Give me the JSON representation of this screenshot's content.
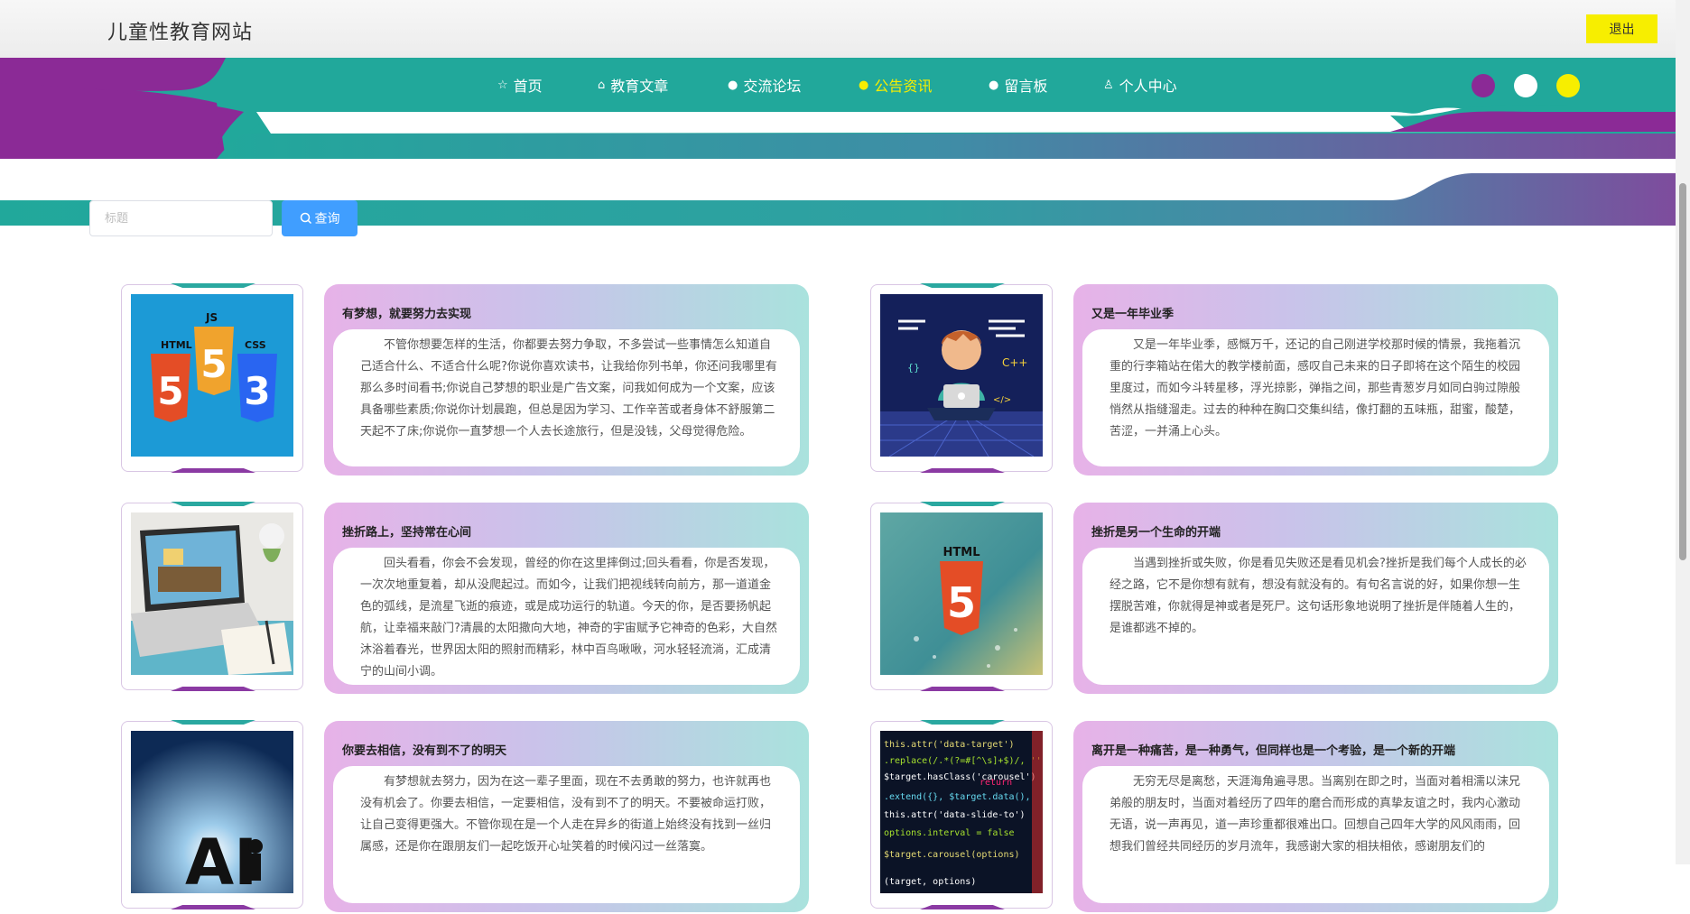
{
  "header": {
    "site_title": "儿童性教育网站",
    "logout_label": "退出"
  },
  "nav": [
    {
      "label": "首页",
      "icon": "star-icon",
      "glyph": "☆"
    },
    {
      "label": "教育文章",
      "icon": "bag-icon",
      "glyph": "⌂"
    },
    {
      "label": "交流论坛",
      "icon": "warning-circle-icon",
      "glyph": "●"
    },
    {
      "label": "公告资讯",
      "icon": "question-circle-icon",
      "glyph": "●",
      "active": true
    },
    {
      "label": "留言板",
      "icon": "info-circle-icon",
      "glyph": "●"
    },
    {
      "label": "个人中心",
      "icon": "user-icon",
      "glyph": "♙"
    }
  ],
  "theme_dots": [
    "#8b2a96",
    "#ffffff",
    "#f7ee00"
  ],
  "search": {
    "placeholder": "标题",
    "button_label": "查询"
  },
  "colors": {
    "nav_teal": "#21a89b",
    "nav_purple": "#8b2a96",
    "accent_yellow": "#f7ee00",
    "button_blue": "#409eff"
  },
  "articles": [
    {
      "title": "有梦想，就要努力去实现",
      "body": "不管你想要怎样的生活，你都要去努力争取，不多尝试一些事情怎么知道自己适合什么、不适合什么呢?你说你喜欢读书，让我给你列书单，你还问我哪里有那么多时间看书;你说自己梦想的职业是广告文案，问我如何成为一个文案，应该具备哪些素质;你说你计划晨跑，但总是因为学习、工作辛苦或者身体不舒服第二天起不了床;你说你一直梦想一个人去长途旅行，但是没钱，父母觉得危险。",
      "image": "html5-css3-js-badges"
    },
    {
      "title": "又是一年毕业季",
      "body": "又是一年毕业季，感慨万千，还记的自己刚进学校那时候的情景，我拖着沉重的行李箱站在偌大的教学楼前面，感叹自己未来的日子即将在这个陌生的校园里度过，而如今斗转星移，浮光掠影，弹指之间，那些青葱岁月如同白驹过隙般悄然从指缝溜走。过去的种种在胸口交集纠结，像打翻的五味瓶，甜蜜，酸楚，苦涩，一并涌上心头。",
      "image": "meditating-coder-illustration"
    },
    {
      "title": "挫折路上，坚持常在心间",
      "body": "回头看看，你会不会发现，曾经的你在这里摔倒过;回头看看，你是否发现，一次次地重复着，却从没爬起过。而如今，让我们把视线转向前方，那一道道金色的弧线，是流星飞逝的痕迹，或是成功运行的轨道。今天的你，是否要扬帆起航，让幸福来敲门?清晨的太阳撒向大地，神奇的宇宙赋予它神奇的色彩，大自然沐浴着春光，世界因太阳的照射而精彩，林中百鸟啾啾，河水轻轻流淌，汇成清宁的山间小调。",
      "image": "laptop-desk-photo"
    },
    {
      "title": "挫折是另一个生命的开端",
      "body": "当遇到挫折或失败，你是看见失败还是看见机会?挫折是我们每个人成长的必经之路，它不是你想有就有，想没有就没有的。有句名言说的好，如果你想一生摆脱苦难，你就得是神或者是死尸。这句话形象地说明了挫折是伴随着人生的，是谁都逃不掉的。",
      "image": "html5-tech-background"
    },
    {
      "title": "你要去相信，没有到不了的明天",
      "body": "有梦想就去努力，因为在这一辈子里面，现在不去勇敢的努力，也许就再也没有机会了。你要去相信，一定要相信，没有到不了的明天。不要被命运打败，让自己变得更强大。不管你现在是一个人走在异乡的街道上始终没有找到一丝归属感，还是你在跟朋友们一起吃饭开心址笑着的时候闪过一丝落寞。",
      "image": "sunset-letters-photo"
    },
    {
      "title": "离开是一种痛苦，是一种勇气，但同样也是一个考验，是一个新的开端",
      "body": "无穷无尽是离愁，天涯海角遍寻思。当离别在即之时，当面对着相濡以沫兄弟般的朋友时，当面对着经历了四年的磨合而形成的真挚友谊之时，我内心激动无语，说一声再见，道一声珍重都很难出口。回想自己四年大学的风风雨雨，回想我们曾经共同经历的岁月流年，我感谢大家的相扶相依，感谢朋友们的",
      "image": "code-screen-photo"
    }
  ]
}
